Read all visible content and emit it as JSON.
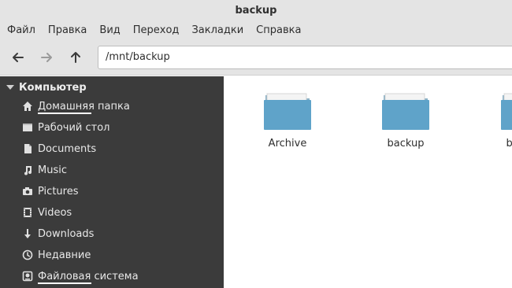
{
  "window": {
    "title": "backup"
  },
  "menubar": {
    "items": [
      "Файл",
      "Правка",
      "Вид",
      "Переход",
      "Закладки",
      "Справка"
    ]
  },
  "toolbar": {
    "back_icon": "arrow-left-icon",
    "forward_icon": "arrow-right-icon",
    "up_icon": "arrow-up-icon",
    "location": "/mnt/backup"
  },
  "sidebar": {
    "header": "Компьютер",
    "items": [
      {
        "label": "Домашняя папка",
        "icon": "home-icon",
        "underline": true
      },
      {
        "label": "Рабочий стол",
        "icon": "desktop-icon"
      },
      {
        "label": "Documents",
        "icon": "document-icon"
      },
      {
        "label": "Music",
        "icon": "music-icon"
      },
      {
        "label": "Pictures",
        "icon": "camera-icon"
      },
      {
        "label": "Videos",
        "icon": "film-icon"
      },
      {
        "label": "Downloads",
        "icon": "download-icon"
      },
      {
        "label": "Недавние",
        "icon": "clock-icon"
      },
      {
        "label": "Файловая система",
        "icon": "drive-icon",
        "underline": true
      }
    ]
  },
  "content": {
    "folders": [
      {
        "label": "Archive"
      },
      {
        "label": "backup"
      },
      {
        "label": "backup"
      }
    ],
    "folder_color": "#5fa3c9"
  },
  "colors": {
    "sidebar_bg": "#3b3b3b",
    "chrome_bg": "#e4e4e4",
    "accent": "#5fa3c9"
  }
}
